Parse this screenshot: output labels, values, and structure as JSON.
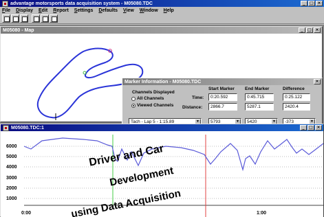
{
  "app": {
    "title": "advantage motorsports data acquisition system - M05080.TDC"
  },
  "menu": [
    "File",
    "Display",
    "Edit",
    "Report",
    "Settings",
    "Defaults",
    "View",
    "Window",
    "Help"
  ],
  "toolbar": {
    "buttons": [
      "new-icon",
      "open-icon",
      "save-icon",
      "print-icon",
      "help-icon",
      "context-help-icon"
    ]
  },
  "map_window": {
    "title": "M05080 - Map"
  },
  "marker_dialog": {
    "title": "Marker Information - M05080.TDC",
    "channels_label": "Channels Displayed",
    "all_channels": "All Channels",
    "viewed_channels": "Viewed Channels",
    "viewed_selected": true,
    "col_start": "Start Marker",
    "col_end": "End Marker",
    "col_diff": "Difference",
    "time_label": "Time:",
    "distance_label": "Distance:",
    "time_start": "0:20.592",
    "time_end": "0:45.715",
    "time_diff": "0:25.122",
    "dist_start": "2866.7",
    "dist_end": "5287.1",
    "dist_diff": "2420.4",
    "channel_select": "Tach - Lap 5 - 1:15.89",
    "val_start": "5793",
    "val_end": "5420",
    "val_diff": "-373"
  },
  "graph_window": {
    "title": "M05080.TDC:1",
    "y_ticks": [
      "6000",
      "5000",
      "4000",
      "3000",
      "2000",
      "1000"
    ],
    "x_ticks": [
      "0:00",
      "1:00"
    ]
  },
  "overlay": {
    "line1": "Driver and Car",
    "line2": "Development",
    "line3": "using Data Acquisition"
  },
  "colors": {
    "title_active": "#0a0a80",
    "trace": "#5a5ad8",
    "start_marker": "#44cc44",
    "end_marker": "#e04040"
  }
}
